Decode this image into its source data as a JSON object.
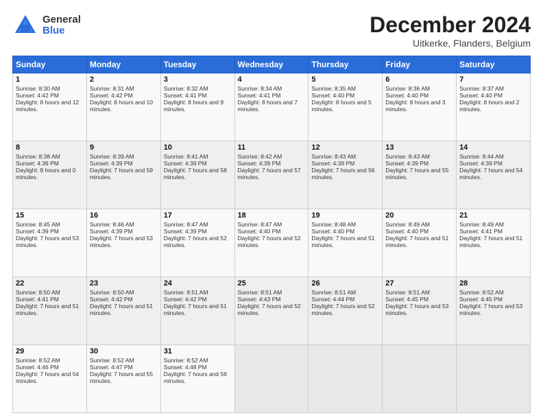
{
  "header": {
    "logo_general": "General",
    "logo_blue": "Blue",
    "month_title": "December 2024",
    "location": "Uitkerke, Flanders, Belgium"
  },
  "weekdays": [
    "Sunday",
    "Monday",
    "Tuesday",
    "Wednesday",
    "Thursday",
    "Friday",
    "Saturday"
  ],
  "weeks": [
    [
      {
        "day": "1",
        "sunrise": "Sunrise: 8:30 AM",
        "sunset": "Sunset: 4:42 PM",
        "daylight": "Daylight: 8 hours and 12 minutes."
      },
      {
        "day": "2",
        "sunrise": "Sunrise: 8:31 AM",
        "sunset": "Sunset: 4:42 PM",
        "daylight": "Daylight: 8 hours and 10 minutes."
      },
      {
        "day": "3",
        "sunrise": "Sunrise: 8:32 AM",
        "sunset": "Sunset: 4:41 PM",
        "daylight": "Daylight: 8 hours and 9 minutes."
      },
      {
        "day": "4",
        "sunrise": "Sunrise: 8:34 AM",
        "sunset": "Sunset: 4:41 PM",
        "daylight": "Daylight: 8 hours and 7 minutes."
      },
      {
        "day": "5",
        "sunrise": "Sunrise: 8:35 AM",
        "sunset": "Sunset: 4:40 PM",
        "daylight": "Daylight: 8 hours and 5 minutes."
      },
      {
        "day": "6",
        "sunrise": "Sunrise: 8:36 AM",
        "sunset": "Sunset: 4:40 PM",
        "daylight": "Daylight: 8 hours and 3 minutes."
      },
      {
        "day": "7",
        "sunrise": "Sunrise: 8:37 AM",
        "sunset": "Sunset: 4:40 PM",
        "daylight": "Daylight: 8 hours and 2 minutes."
      }
    ],
    [
      {
        "day": "8",
        "sunrise": "Sunrise: 8:38 AM",
        "sunset": "Sunset: 4:39 PM",
        "daylight": "Daylight: 8 hours and 0 minutes."
      },
      {
        "day": "9",
        "sunrise": "Sunrise: 8:39 AM",
        "sunset": "Sunset: 4:39 PM",
        "daylight": "Daylight: 7 hours and 59 minutes."
      },
      {
        "day": "10",
        "sunrise": "Sunrise: 8:41 AM",
        "sunset": "Sunset: 4:39 PM",
        "daylight": "Daylight: 7 hours and 58 minutes."
      },
      {
        "day": "11",
        "sunrise": "Sunrise: 8:42 AM",
        "sunset": "Sunset: 4:39 PM",
        "daylight": "Daylight: 7 hours and 57 minutes."
      },
      {
        "day": "12",
        "sunrise": "Sunrise: 8:43 AM",
        "sunset": "Sunset: 4:39 PM",
        "daylight": "Daylight: 7 hours and 56 minutes."
      },
      {
        "day": "13",
        "sunrise": "Sunrise: 8:43 AM",
        "sunset": "Sunset: 4:39 PM",
        "daylight": "Daylight: 7 hours and 55 minutes."
      },
      {
        "day": "14",
        "sunrise": "Sunrise: 8:44 AM",
        "sunset": "Sunset: 4:39 PM",
        "daylight": "Daylight: 7 hours and 54 minutes."
      }
    ],
    [
      {
        "day": "15",
        "sunrise": "Sunrise: 8:45 AM",
        "sunset": "Sunset: 4:39 PM",
        "daylight": "Daylight: 7 hours and 53 minutes."
      },
      {
        "day": "16",
        "sunrise": "Sunrise: 8:46 AM",
        "sunset": "Sunset: 4:39 PM",
        "daylight": "Daylight: 7 hours and 53 minutes."
      },
      {
        "day": "17",
        "sunrise": "Sunrise: 8:47 AM",
        "sunset": "Sunset: 4:39 PM",
        "daylight": "Daylight: 7 hours and 52 minutes."
      },
      {
        "day": "18",
        "sunrise": "Sunrise: 8:47 AM",
        "sunset": "Sunset: 4:40 PM",
        "daylight": "Daylight: 7 hours and 52 minutes."
      },
      {
        "day": "19",
        "sunrise": "Sunrise: 8:48 AM",
        "sunset": "Sunset: 4:40 PM",
        "daylight": "Daylight: 7 hours and 51 minutes."
      },
      {
        "day": "20",
        "sunrise": "Sunrise: 8:49 AM",
        "sunset": "Sunset: 4:40 PM",
        "daylight": "Daylight: 7 hours and 51 minutes."
      },
      {
        "day": "21",
        "sunrise": "Sunrise: 8:49 AM",
        "sunset": "Sunset: 4:41 PM",
        "daylight": "Daylight: 7 hours and 51 minutes."
      }
    ],
    [
      {
        "day": "22",
        "sunrise": "Sunrise: 8:50 AM",
        "sunset": "Sunset: 4:41 PM",
        "daylight": "Daylight: 7 hours and 51 minutes."
      },
      {
        "day": "23",
        "sunrise": "Sunrise: 8:50 AM",
        "sunset": "Sunset: 4:42 PM",
        "daylight": "Daylight: 7 hours and 51 minutes."
      },
      {
        "day": "24",
        "sunrise": "Sunrise: 8:51 AM",
        "sunset": "Sunset: 4:42 PM",
        "daylight": "Daylight: 7 hours and 51 minutes."
      },
      {
        "day": "25",
        "sunrise": "Sunrise: 8:51 AM",
        "sunset": "Sunset: 4:43 PM",
        "daylight": "Daylight: 7 hours and 52 minutes."
      },
      {
        "day": "26",
        "sunrise": "Sunrise: 8:51 AM",
        "sunset": "Sunset: 4:44 PM",
        "daylight": "Daylight: 7 hours and 52 minutes."
      },
      {
        "day": "27",
        "sunrise": "Sunrise: 8:51 AM",
        "sunset": "Sunset: 4:45 PM",
        "daylight": "Daylight: 7 hours and 53 minutes."
      },
      {
        "day": "28",
        "sunrise": "Sunrise: 8:52 AM",
        "sunset": "Sunset: 4:45 PM",
        "daylight": "Daylight: 7 hours and 53 minutes."
      }
    ],
    [
      {
        "day": "29",
        "sunrise": "Sunrise: 8:52 AM",
        "sunset": "Sunset: 4:46 PM",
        "daylight": "Daylight: 7 hours and 54 minutes."
      },
      {
        "day": "30",
        "sunrise": "Sunrise: 8:52 AM",
        "sunset": "Sunset: 4:47 PM",
        "daylight": "Daylight: 7 hours and 55 minutes."
      },
      {
        "day": "31",
        "sunrise": "Sunrise: 8:52 AM",
        "sunset": "Sunset: 4:48 PM",
        "daylight": "Daylight: 7 hours and 56 minutes."
      },
      null,
      null,
      null,
      null
    ]
  ]
}
